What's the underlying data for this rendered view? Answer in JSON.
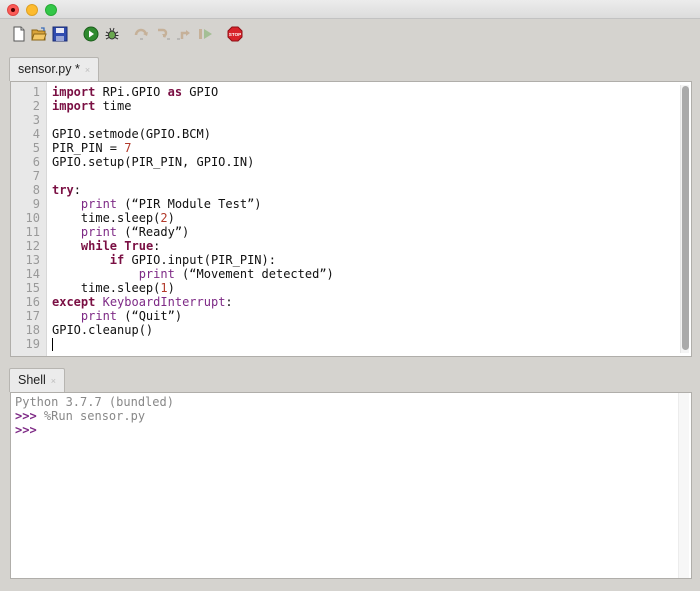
{
  "window": {
    "title": "",
    "controls": [
      "close",
      "minimize",
      "maximize"
    ]
  },
  "toolbar": {
    "buttons": [
      {
        "name": "new-file",
        "icon": "new-file-icon",
        "enabled": true
      },
      {
        "name": "open-file",
        "icon": "open-folder-icon",
        "enabled": true
      },
      {
        "name": "save",
        "icon": "save-icon",
        "enabled": true
      },
      {
        "name": "run",
        "icon": "run-icon",
        "enabled": true
      },
      {
        "name": "debug",
        "icon": "debug-bug-icon",
        "enabled": true
      },
      {
        "name": "step-over",
        "icon": "step-over-icon",
        "enabled": false
      },
      {
        "name": "step-into",
        "icon": "step-into-icon",
        "enabled": false
      },
      {
        "name": "step-out",
        "icon": "step-out-icon",
        "enabled": false
      },
      {
        "name": "resume",
        "icon": "resume-icon",
        "enabled": false
      },
      {
        "name": "stop",
        "icon": "stop-icon",
        "label": "STOP",
        "enabled": true
      }
    ]
  },
  "editor": {
    "tab": {
      "label": "sensor.py *",
      "close": "×"
    },
    "lines": [
      {
        "n": "1",
        "tokens": [
          {
            "t": "import",
            "c": "kw"
          },
          {
            "t": " RPi.GPIO "
          },
          {
            "t": "as",
            "c": "kw"
          },
          {
            "t": " GPIO"
          }
        ]
      },
      {
        "n": "2",
        "tokens": [
          {
            "t": "import",
            "c": "kw"
          },
          {
            "t": " time"
          }
        ]
      },
      {
        "n": "3",
        "tokens": []
      },
      {
        "n": "4",
        "tokens": [
          {
            "t": "GPIO.setmode(GPIO.BCM)"
          }
        ]
      },
      {
        "n": "5",
        "tokens": [
          {
            "t": "PIR_PIN = "
          },
          {
            "t": "7",
            "c": "num"
          }
        ]
      },
      {
        "n": "6",
        "tokens": [
          {
            "t": "GPIO.setup(PIR_PIN, GPIO.IN)"
          }
        ]
      },
      {
        "n": "7",
        "tokens": []
      },
      {
        "n": "8",
        "tokens": [
          {
            "t": "try",
            "c": "kw"
          },
          {
            "t": ":"
          }
        ]
      },
      {
        "n": "9",
        "tokens": [
          {
            "t": "    "
          },
          {
            "t": "print",
            "c": "bi"
          },
          {
            "t": " (“PIR Module Test”)"
          }
        ]
      },
      {
        "n": "10",
        "tokens": [
          {
            "t": "    time.sleep("
          },
          {
            "t": "2",
            "c": "num"
          },
          {
            "t": ")"
          }
        ]
      },
      {
        "n": "11",
        "tokens": [
          {
            "t": "    "
          },
          {
            "t": "print",
            "c": "bi"
          },
          {
            "t": " (“Ready”)"
          }
        ]
      },
      {
        "n": "12",
        "tokens": [
          {
            "t": "    "
          },
          {
            "t": "while",
            "c": "kw"
          },
          {
            "t": " "
          },
          {
            "t": "True",
            "c": "kw"
          },
          {
            "t": ":"
          }
        ]
      },
      {
        "n": "13",
        "tokens": [
          {
            "t": "        "
          },
          {
            "t": "if",
            "c": "kw"
          },
          {
            "t": " GPIO.input(PIR_PIN):"
          }
        ]
      },
      {
        "n": "14",
        "tokens": [
          {
            "t": "            "
          },
          {
            "t": "print",
            "c": "bi"
          },
          {
            "t": " (“Movement detected”)"
          }
        ]
      },
      {
        "n": "15",
        "tokens": [
          {
            "t": "    time.sleep("
          },
          {
            "t": "1",
            "c": "num"
          },
          {
            "t": ")"
          }
        ]
      },
      {
        "n": "16",
        "tokens": [
          {
            "t": "except",
            "c": "kw"
          },
          {
            "t": " "
          },
          {
            "t": "KeyboardInterrupt",
            "c": "bi"
          },
          {
            "t": ":"
          }
        ]
      },
      {
        "n": "17",
        "tokens": [
          {
            "t": "    "
          },
          {
            "t": "print",
            "c": "bi"
          },
          {
            "t": " (“Quit”)"
          }
        ]
      },
      {
        "n": "18",
        "tokens": [
          {
            "t": "GPIO.cleanup()"
          }
        ]
      },
      {
        "n": "19",
        "tokens": [],
        "cursor": true
      }
    ]
  },
  "shell": {
    "tab": {
      "label": "Shell",
      "close": "×"
    },
    "lines": [
      {
        "prompt": "",
        "text": "Python 3.7.7 (bundled)"
      },
      {
        "prompt": ">>>",
        "text": " %Run sensor.py"
      },
      {
        "prompt": ">>>",
        "text": ""
      }
    ]
  },
  "colors": {
    "keyword": "#7a0f43",
    "builtin": "#7e2a86",
    "number": "#b2392a",
    "prompt": "#7e2a86"
  }
}
